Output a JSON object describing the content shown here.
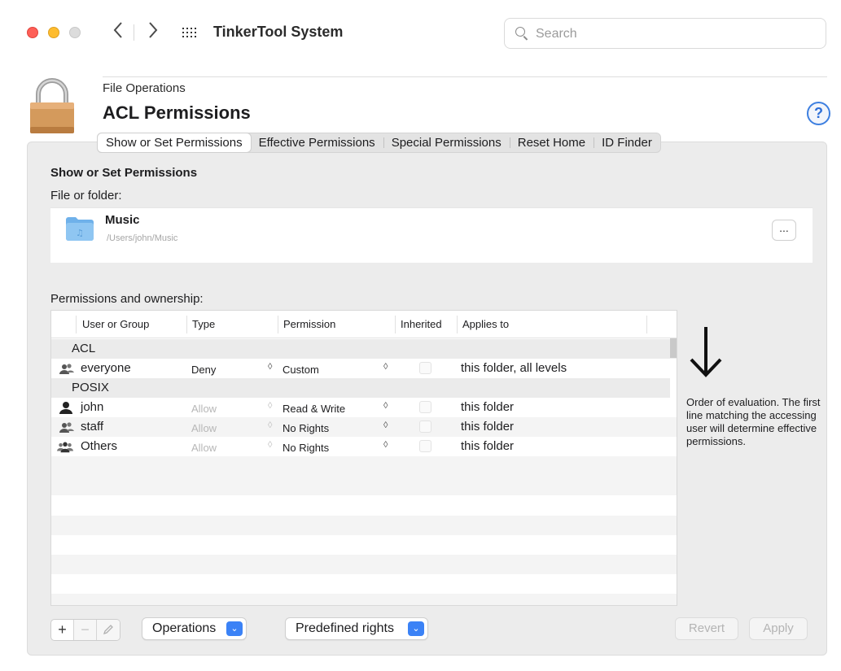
{
  "window": {
    "title": "TinkerTool System",
    "search_placeholder": "Search"
  },
  "header": {
    "section": "File Operations",
    "title": "ACL Permissions",
    "help_label": "?"
  },
  "tabs": [
    {
      "label": "Show or Set Permissions",
      "active": true
    },
    {
      "label": "Effective Permissions",
      "active": false
    },
    {
      "label": "Special Permissions",
      "active": false
    },
    {
      "label": "Reset Home",
      "active": false
    },
    {
      "label": "ID Finder",
      "active": false
    }
  ],
  "main": {
    "subhead": "Show or Set Permissions",
    "file_label": "File or folder:",
    "file": {
      "name": "Music",
      "path": "/Users/john/Music",
      "more_label": "..."
    },
    "perm_label": "Permissions and ownership:"
  },
  "table": {
    "columns": [
      "User or Group",
      "Type",
      "Permission",
      "Inherited",
      "Applies to"
    ],
    "group_acl": "ACL",
    "group_posix": "POSIX",
    "rows": [
      {
        "user": "everyone",
        "type": "Deny",
        "permission": "Custom",
        "applies": "this folder, all levels",
        "icon": "group-icon"
      },
      {
        "user": "john",
        "type": "Allow",
        "permission": "Read & Write",
        "applies": "this folder",
        "icon": "user-icon"
      },
      {
        "user": "staff",
        "type": "Allow",
        "permission": "No Rights",
        "applies": "this folder",
        "icon": "group-icon"
      },
      {
        "user": "Others",
        "type": "Allow",
        "permission": "No Rights",
        "applies": "this folder",
        "icon": "others-icon"
      }
    ]
  },
  "note": "Order of evaluation. The first line matching the accessing user will determine effective permissions.",
  "bottom": {
    "add": "+",
    "remove": "−",
    "operations": "Operations",
    "predefined": "Predefined rights",
    "revert": "Revert",
    "apply": "Apply"
  },
  "colors": {
    "accent": "#3b82f6",
    "pane": "#ececec"
  }
}
